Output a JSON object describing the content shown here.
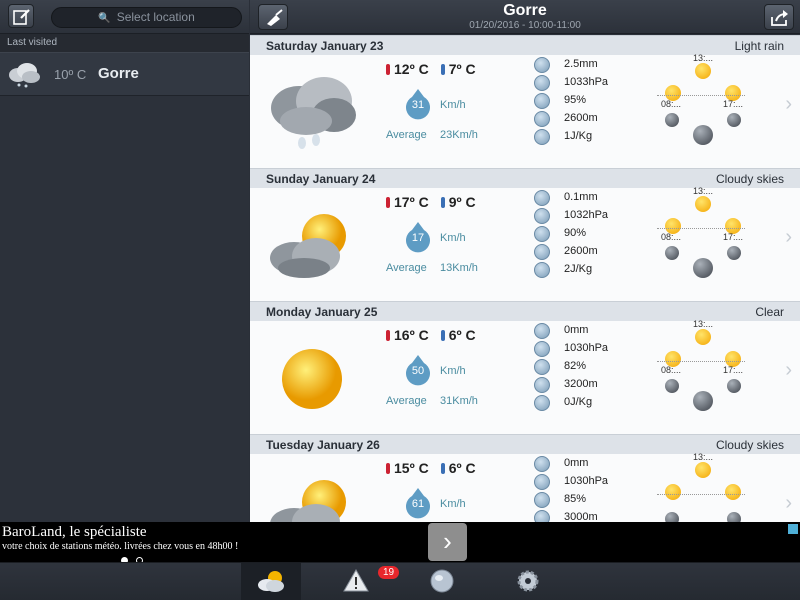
{
  "sidebar": {
    "search_placeholder": "Select location",
    "section_label": "Last visited",
    "location": {
      "temp": "10º C",
      "name": "Gorre"
    }
  },
  "header": {
    "title": "Gorre",
    "subtitle": "01/20/2016 - 10:00-11:00"
  },
  "days": [
    {
      "date": "Saturday January 23",
      "condition": "Light rain",
      "icon": "cloud-rain-icon",
      "max": "12º C",
      "min": "7º C",
      "wind": "31",
      "wind_unit": "Km/h",
      "avg_label": "Average",
      "avg": "23Km/h",
      "metrics": [
        "2.5mm",
        "1033hPa",
        "95%",
        "2600m",
        "1J/Kg"
      ],
      "sun_noon": "13:...",
      "sunrise": "08:...",
      "sunset": "17:..."
    },
    {
      "date": "Sunday January 24",
      "condition": "Cloudy skies",
      "icon": "cloud-sun-icon",
      "max": "17º C",
      "min": "9º C",
      "wind": "17",
      "wind_unit": "Km/h",
      "avg_label": "Average",
      "avg": "13Km/h",
      "metrics": [
        "0.1mm",
        "1032hPa",
        "90%",
        "2600m",
        "2J/Kg"
      ],
      "sun_noon": "13:...",
      "sunrise": "08:...",
      "sunset": "17:..."
    },
    {
      "date": "Monday January 25",
      "condition": "Clear",
      "icon": "sun-icon",
      "max": "16º C",
      "min": "6º C",
      "wind": "50",
      "wind_unit": "Km/h",
      "avg_label": "Average",
      "avg": "31Km/h",
      "metrics": [
        "0mm",
        "1030hPa",
        "82%",
        "3200m",
        "0J/Kg"
      ],
      "sun_noon": "13:...",
      "sunrise": "08:...",
      "sunset": "17:..."
    },
    {
      "date": "Tuesday January 26",
      "condition": "Cloudy skies",
      "icon": "cloud-sun-icon",
      "max": "15º C",
      "min": "6º C",
      "wind": "61",
      "wind_unit": "Km/h",
      "avg_label": "",
      "avg": "",
      "metrics": [
        "0mm",
        "1030hPa",
        "85%",
        "3000m",
        ""
      ],
      "sun_noon": "13:...",
      "sunrise": "",
      "sunset": ""
    }
  ],
  "ad": {
    "title": "BaroLand, le spécialiste",
    "text": "votre choix de stations météo. livrées chez vous en 48h00 !",
    "next_glyph": "›"
  },
  "tabs": {
    "alerts_badge": "19"
  }
}
